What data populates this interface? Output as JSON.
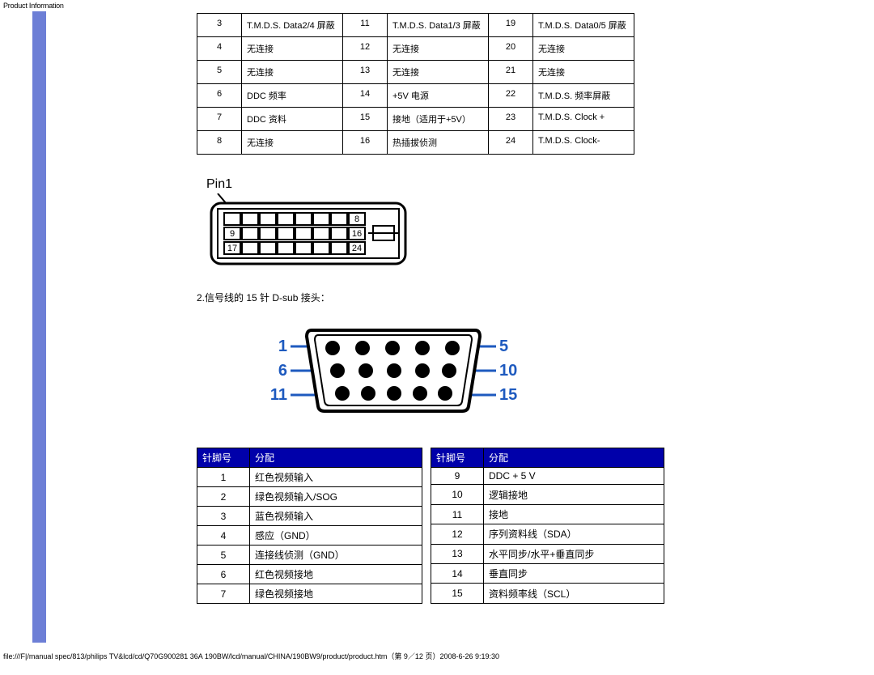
{
  "header": {
    "title": "Product Information"
  },
  "dvi_table": {
    "rows": [
      [
        "3",
        "T.M.D.S. Data2/4 屏蔽",
        "11",
        "T.M.D.S. Data1/3 屏蔽",
        "19",
        "T.M.D.S. Data0/5 屏蔽"
      ],
      [
        "4",
        "无连接",
        "12",
        "无连接",
        "20",
        "无连接"
      ],
      [
        "5",
        "无连接",
        "13",
        "无连接",
        "21",
        "无连接"
      ],
      [
        "6",
        "DDC 频率",
        "14",
        "+5V 电源",
        "22",
        "T.M.D.S. 频率屏蔽"
      ],
      [
        "7",
        "DDC 资料",
        "15",
        "接地（适用于+5V）",
        "23",
        "T.M.D.S. Clock +"
      ],
      [
        "8",
        "无连接",
        "16",
        "热插拔侦测",
        "24",
        "T.M.D.S. Clock-"
      ]
    ]
  },
  "dvi_diagram": {
    "pin1_label": "Pin1",
    "grid_numbers": {
      "top_right": "8",
      "mid_left": "9",
      "mid_right": "16",
      "bot_left": "17",
      "bot_right": "24"
    }
  },
  "dsub_intro": "2.信号线的 15 针 D-sub 接头：",
  "dsub_diagram": {
    "left_labels": [
      "1",
      "6",
      "11"
    ],
    "right_labels": [
      "5",
      "10",
      "15"
    ]
  },
  "dsub_table": {
    "headers": {
      "pin": "针脚号",
      "alloc": "分配"
    },
    "left": [
      [
        "1",
        "红色视频输入"
      ],
      [
        "2",
        "绿色视频输入/SOG"
      ],
      [
        "3",
        "蓝色视频输入"
      ],
      [
        "4",
        "感应（GND）"
      ],
      [
        "5",
        "连接线侦测（GND）"
      ],
      [
        "6",
        "红色视频接地"
      ],
      [
        "7",
        "绿色视频接地"
      ]
    ],
    "right": [
      [
        "9",
        "DDC + 5 V"
      ],
      [
        "10",
        "逻辑接地"
      ],
      [
        "11",
        "接地"
      ],
      [
        "12",
        "序列资料线（SDA）"
      ],
      [
        "13",
        "水平同步/水平+垂直同步"
      ],
      [
        "14",
        "垂直同步"
      ],
      [
        "15",
        "资料频率线（SCL）"
      ]
    ]
  },
  "footer": {
    "path": "file:///F|/manual spec/813/philips TV&lcd/cd/Q70G900281 36A 190BW/lcd/manual/CHINA/190BW9/product/product.htm（第 9／12 页）2008-6-26 9:19:30"
  }
}
